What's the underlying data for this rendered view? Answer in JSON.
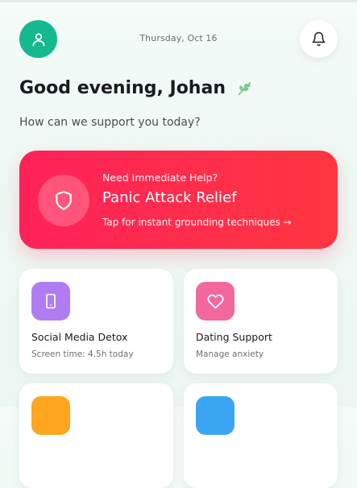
{
  "header": {
    "date": "Thursday, Oct 16",
    "avatar_icon": "user-icon",
    "notification_icon": "bell-icon"
  },
  "greeting": {
    "title": "Good evening, Johan",
    "decor_icon": "leaf-icon",
    "subtitle": "How can we support you today?"
  },
  "panic_card": {
    "eyebrow": "Need Immediate Help?",
    "title": "Panic Attack Relief",
    "link": "Tap for instant grounding techniques →",
    "icon": "shield-icon",
    "color": "#ff2a52"
  },
  "tiles": [
    {
      "title": "Social Media Detox",
      "subtitle": "Screen time: 4.5h today",
      "icon": "phone-icon",
      "color": "#b07cf4"
    },
    {
      "title": "Dating Support",
      "subtitle": "Manage anxiety",
      "icon": "heart-icon",
      "color": "#f2679e"
    },
    {
      "icon": "tile-icon",
      "color": "#ffa51e"
    },
    {
      "icon": "tile-icon",
      "color": "#3aa6f3"
    }
  ],
  "colors": {
    "accent": "#16b98e",
    "background": "#eef8f4"
  }
}
